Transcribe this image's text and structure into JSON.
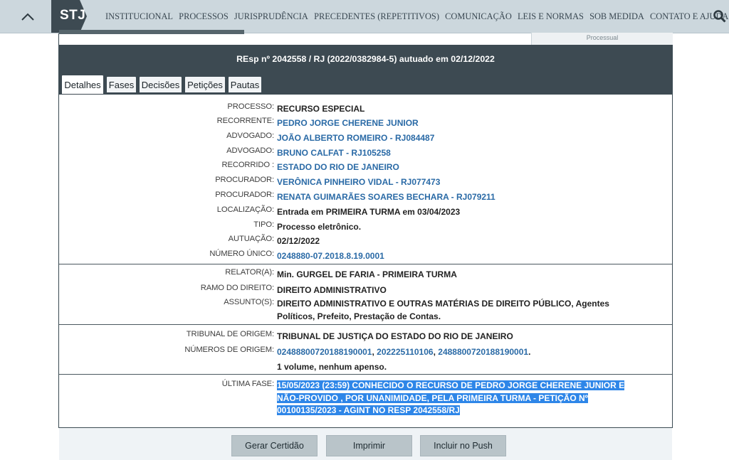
{
  "nav": {
    "logo": "STJ",
    "items": [
      "INSTITUCIONAL",
      "PROCESSOS",
      "JURISPRUDÊNCIA",
      "PRECEDENTES (REPETITIVOS)",
      "COMUNICAÇÃO",
      "LEIS E NORMAS",
      "SOB MEDIDA",
      "CONTATO E AJUDA"
    ],
    "collapse_icon": "chevron-up-icon",
    "search_icon": "search-icon"
  },
  "ghost_tab_label": "Processual",
  "header": {
    "title": "REsp nº 2042558 / RJ (2022/0382984-5) autuado em 02/12/2022"
  },
  "tabs": [
    "Detalhes",
    "Fases",
    "Decisões",
    "Petições",
    "Pautas"
  ],
  "fields": {
    "processo": {
      "label": "PROCESSO:",
      "value": "RECURSO ESPECIAL"
    },
    "recorrente": {
      "label": "RECORRENTE:",
      "value": "PEDRO JORGE CHERENE JUNIOR"
    },
    "advogado1": {
      "label": "ADVOGADO:",
      "value": "JOÃO ALBERTO ROMEIRO - RJ084487"
    },
    "advogado2": {
      "label": "ADVOGADO:",
      "value": "BRUNO CALFAT - RJ105258"
    },
    "recorrido": {
      "label": "RECORRIDO :",
      "value": "ESTADO DO RIO DE JANEIRO"
    },
    "procurador1": {
      "label": "PROCURADOR:",
      "value": "VERÔNICA PINHEIRO VIDAL - RJ077473"
    },
    "procurador2": {
      "label": "PROCURADOR:",
      "value": "RENATA GUIMARÃES SOARES BECHARA - RJ079211"
    },
    "localizacao": {
      "label": "LOCALIZAÇÃO:",
      "value": "Entrada em PRIMEIRA TURMA em 03/04/2023"
    },
    "tipo": {
      "label": "TIPO:",
      "value": "Processo eletrônico."
    },
    "autuacao": {
      "label": "AUTUAÇÃO:",
      "value": "02/12/2022"
    },
    "numero_unico": {
      "label": "NÚMERO ÚNICO:",
      "value": "0248880-07.2018.8.19.0001"
    },
    "relator": {
      "label": "RELATOR(A):",
      "value": "Min. GURGEL DE FARIA - PRIMEIRA TURMA"
    },
    "ramo": {
      "label": "RAMO DO DIREITO:",
      "value": "DIREITO ADMINISTRATIVO"
    },
    "assuntos": {
      "label": "ASSUNTO(S):",
      "value": "DIREITO ADMINISTRATIVO E OUTRAS MATÉRIAS DE DIREITO PÚBLICO, Agentes Políticos, Prefeito, Prestação de Contas."
    },
    "tribunal": {
      "label": "TRIBUNAL DE ORIGEM:",
      "value": "TRIBUNAL DE JUSTIÇA DO ESTADO DO RIO DE JANEIRO"
    },
    "numeros_origem": {
      "label": "NÚMEROS DE ORIGEM:",
      "values": [
        "02488800720188190001",
        "202225110106",
        "2488800720188190001"
      ]
    },
    "volume": {
      "value": "1 volume, nenhum apenso."
    },
    "ultima_fase": {
      "label": "ÚLTIMA FASE:",
      "lines": [
        "15/05/2023 (23:59) CONHECIDO O RECURSO DE PEDRO JORGE CHERENE JUNIOR E",
        "NÃO-PROVIDO , POR UNANIMIDADE, PELA PRIMEIRA TURMA - PETIÇÃO Nº",
        "00100135/2023 - AGINT NO RESP 2042558/RJ"
      ]
    }
  },
  "footer": {
    "buttons": [
      "Gerar Certidão",
      "Imprimir",
      "Incluir no Push"
    ]
  },
  "colors": {
    "nav_bg": "#ccd7dd",
    "header_bg": "#3d4a52",
    "link": "#2a6aa6",
    "highlight": "#2e86e8"
  }
}
